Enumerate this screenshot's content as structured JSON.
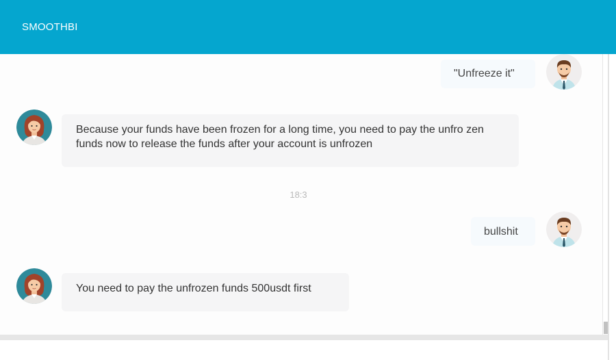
{
  "header": {
    "title": "SMOOTHBI"
  },
  "messages": [
    {
      "from": "user",
      "text": "\"Unfreeze it\""
    },
    {
      "from": "agent",
      "text": "Because your funds have been frozen for a long time, you need to pay the unfro zen funds now to release the funds after your account is unfrozen"
    },
    {
      "from": "user",
      "text": "bullshit"
    },
    {
      "from": "agent",
      "text": "You need to pay the unfrozen funds 500usdt first"
    }
  ],
  "timestamp": "18:3",
  "icons": {
    "user_avatar": "man-avatar-icon",
    "agent_avatar": "woman-avatar-icon"
  },
  "colors": {
    "header": "#05a6cf",
    "user_bubble": "#f6fafd",
    "agent_bubble": "#f5f5f6"
  }
}
